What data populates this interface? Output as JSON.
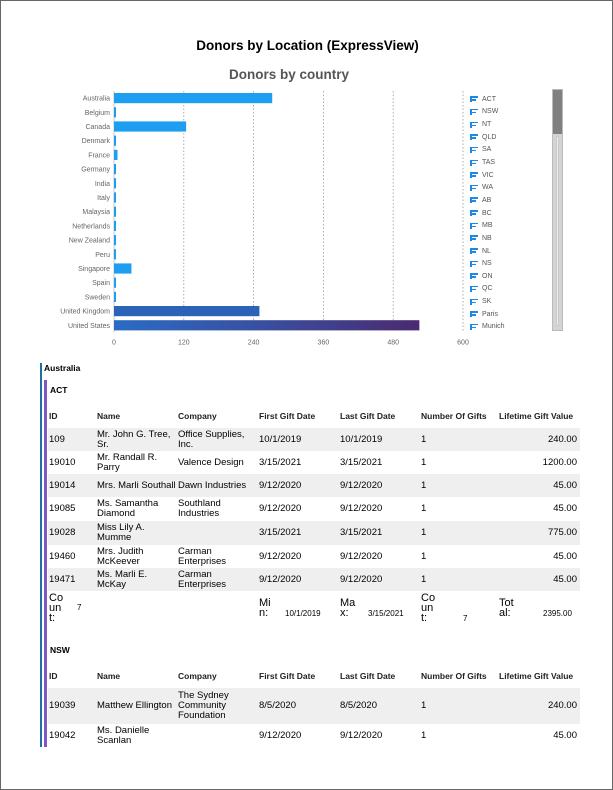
{
  "report": {
    "title": "Donors by Location (ExpressView)"
  },
  "chart_data": {
    "type": "bar",
    "orientation": "horizontal",
    "title": "Donors by country",
    "categories": [
      "Australia",
      "Belgium",
      "Canada",
      "Denmark",
      "France",
      "Germany",
      "India",
      "Italy",
      "Malaysia",
      "Netherlands",
      "New Zealand",
      "Peru",
      "Singapore",
      "Spain",
      "Sweden",
      "United Kingdom",
      "United States"
    ],
    "values": [
      272,
      3,
      124,
      1,
      6,
      2,
      2,
      1,
      3,
      1,
      2,
      1,
      30,
      1,
      1,
      250,
      525
    ],
    "x_ticks": [
      "0",
      "120",
      "240",
      "360",
      "480",
      "600"
    ],
    "xlim": [
      0,
      600
    ],
    "colors": [
      "#1e9ef0",
      "#1e9ef0",
      "#1e9ef0",
      "#1e9ef0",
      "#1e9ef0",
      "#1e9ef0",
      "#1e9ef0",
      "#1e9ef0",
      "#1e9ef0",
      "#1e9ef0",
      "#1e9ef0",
      "#1e9ef0",
      "#1e9ef0",
      "#1e9ef0",
      "#1e9ef0",
      "#2a63b8",
      "#3a4a9a"
    ],
    "legend": [
      "ACT",
      "NSW",
      "NT",
      "QLD",
      "SA",
      "TAS",
      "VIC",
      "WA",
      "AB",
      "BC",
      "MB",
      "NB",
      "NL",
      "NS",
      "ON",
      "QC",
      "SK",
      "Paris",
      "Munich"
    ],
    "legend_position": "right",
    "grid": true
  },
  "country": "Australia",
  "headers": [
    "ID",
    "Name",
    "Company",
    "First Gift Date",
    "Last Gift Date",
    "Number Of Gifts",
    "Lifetime Gift Value"
  ],
  "groups": [
    {
      "state": "ACT",
      "rows": [
        {
          "id": "109",
          "name": "Mr. John G. Tree, Sr.",
          "company": "Office Supplies, Inc.",
          "first": "10/1/2019",
          "last": "10/1/2019",
          "gifts": "1",
          "value": "240.00"
        },
        {
          "id": "19010",
          "name": "Mr. Randall R. Parry",
          "company": "Valence Design",
          "first": "3/15/2021",
          "last": "3/15/2021",
          "gifts": "1",
          "value": "1200.00"
        },
        {
          "id": "19014",
          "name": "Mrs. Marli Southall",
          "company": "Dawn Industries",
          "first": "9/12/2020",
          "last": "9/12/2020",
          "gifts": "1",
          "value": "45.00"
        },
        {
          "id": "19085",
          "name": "Ms. Samantha Diamond",
          "company": "Southland Industries",
          "first": "9/12/2020",
          "last": "9/12/2020",
          "gifts": "1",
          "value": "45.00"
        },
        {
          "id": "19028",
          "name": "Miss Lily A. Mumme",
          "company": "",
          "first": "3/15/2021",
          "last": "3/15/2021",
          "gifts": "1",
          "value": "775.00"
        },
        {
          "id": "19460",
          "name": "Mrs. Judith McKeever",
          "company": "Carman Enterprises",
          "first": "9/12/2020",
          "last": "9/12/2020",
          "gifts": "1",
          "value": "45.00"
        },
        {
          "id": "19471",
          "name": "Ms. Marli E. McKay",
          "company": "Carman Enterprises",
          "first": "9/12/2020",
          "last": "9/12/2020",
          "gifts": "1",
          "value": "45.00"
        }
      ],
      "summary": {
        "count_label": "Count:",
        "count": "7",
        "min_label": "Min:",
        "min": "10/1/2019",
        "max_label": "Max:",
        "max": "3/15/2021",
        "count2_label": "Count:",
        "count2": "7",
        "total_label": "Total:",
        "total": "2395.00"
      }
    },
    {
      "state": "NSW",
      "rows": [
        {
          "id": "19039",
          "name": "Matthew Ellington",
          "company": "The Sydney Community Foundation",
          "first": "8/5/2020",
          "last": "8/5/2020",
          "gifts": "1",
          "value": "240.00"
        },
        {
          "id": "19042",
          "name": "Ms. Danielle Scanlan",
          "company": "",
          "first": "9/12/2020",
          "last": "9/12/2020",
          "gifts": "1",
          "value": "45.00"
        }
      ]
    }
  ]
}
